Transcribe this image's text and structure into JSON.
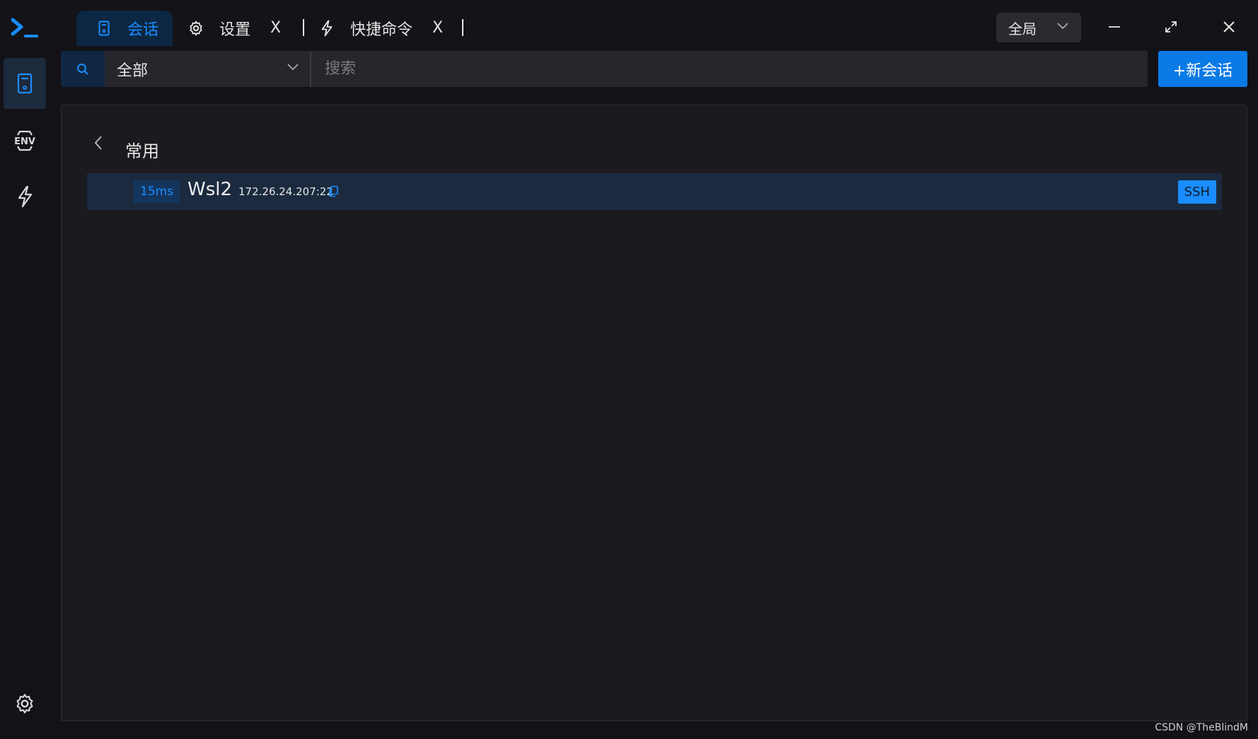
{
  "titlebar": {
    "tabs": [
      {
        "label": "会话",
        "icon": "server-icon",
        "active": true
      },
      {
        "label": "设置",
        "icon": "gear-icon",
        "close": "X"
      },
      {
        "label": "快捷命令",
        "icon": "lightning-icon",
        "close": "X"
      }
    ],
    "scope_select": {
      "value": "全局"
    },
    "window_controls": [
      "minimize-icon",
      "restore-icon",
      "close-icon"
    ]
  },
  "sidebar": {
    "items": [
      {
        "icon": "server-icon",
        "active": true
      },
      {
        "icon": "env-icon",
        "text": "ENV"
      },
      {
        "icon": "lightning-icon"
      }
    ],
    "footer_icon": "gear-icon"
  },
  "toolbar": {
    "filter_value": "全部",
    "search_placeholder": "搜索",
    "new_session_label": "+新会话"
  },
  "group": {
    "title": "常用",
    "sessions": [
      {
        "latency": "15ms",
        "name": "Wsl2",
        "address": "172.26.24.207:22",
        "protocol": "SSH"
      }
    ]
  },
  "watermark": "CSDN @TheBlindM",
  "colors": {
    "accent": "#1a8cff",
    "button_primary": "#0a7ae6",
    "background": "#121217",
    "panel": "#1a1a1f",
    "row_highlight": "#1b2a3f"
  }
}
